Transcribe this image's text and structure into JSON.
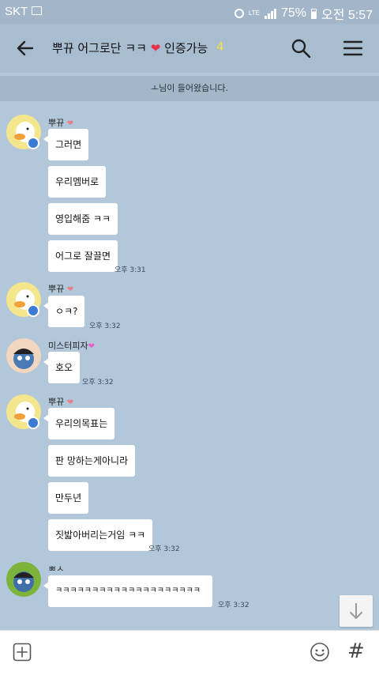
{
  "status_bar": {
    "carrier": "SKT",
    "network": "LTE",
    "battery": "75%",
    "time": "오전 5:57"
  },
  "header": {
    "title": "뿌뀨 어그로단 ㅋㅋ",
    "title_suffix": "인증가능",
    "member_count": "4"
  },
  "notice": "ㅗ님이 들어왔습니다.",
  "messages": [
    {
      "sender": "뿌뀨",
      "bubbles": [
        "그러면",
        "우리멤버로",
        "영입해줌 ㅋㅋ",
        "어그로 잘끌면"
      ],
      "time": "오후 3:31"
    },
    {
      "sender": "뿌뀨",
      "bubbles": [
        "ㅇㅋ?"
      ],
      "time": "오후 3:32"
    },
    {
      "sender": "미스터피자",
      "bubbles": [
        "호오"
      ],
      "time": "오후 3:32"
    },
    {
      "sender": "뿌뀨",
      "bubbles": [
        "우리의목표는",
        "판 망하는게아니라",
        "만두년",
        "짓밟아버리는거임 ㅋㅋ"
      ],
      "time": "오후 3:32"
    },
    {
      "sender": "ㅃㅅ",
      "bubbles": [
        "ㅋㅋㅋㅋㅋㅋㅋㅋㅋㅋㅋㅋㅋㅋㅋㅋㅋㅋㅋㅋ"
      ],
      "time": "오후 3:32"
    }
  ],
  "colors": {
    "background": "#b2c7da",
    "header": "#a9bdd1",
    "heart": "#e5344b",
    "count": "#f5e14a"
  },
  "icons": {
    "back": "back-arrow-icon",
    "search": "search-icon",
    "menu": "menu-icon",
    "plus": "plus-icon",
    "emoji": "emoji-icon",
    "hash": "hash-icon",
    "scroll": "arrow-down-icon"
  }
}
